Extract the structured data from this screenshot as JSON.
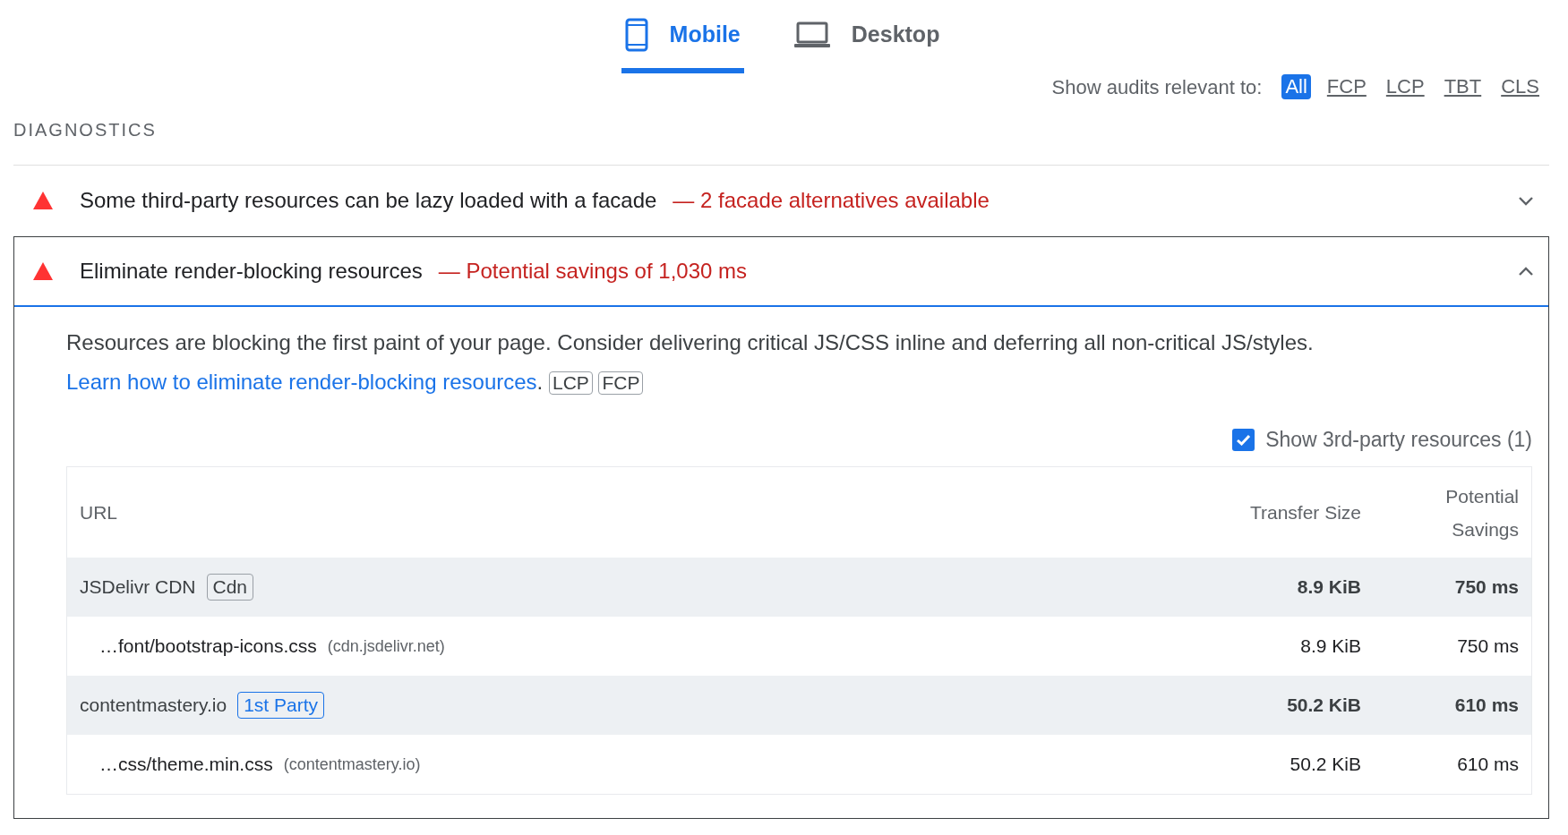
{
  "tabs": [
    {
      "label": "Mobile",
      "kind": "phone",
      "selected": true
    },
    {
      "label": "Desktop",
      "kind": "laptop",
      "selected": false
    }
  ],
  "filter": {
    "label": "Show audits relevant to:",
    "options": [
      {
        "label": "All",
        "selected": true
      },
      {
        "label": "FCP",
        "selected": false
      },
      {
        "label": "LCP",
        "selected": false
      },
      {
        "label": "TBT",
        "selected": false
      },
      {
        "label": "CLS",
        "selected": false
      }
    ]
  },
  "section_title": "DIAGNOSTICS",
  "audits": [
    {
      "title": "Some third-party resources can be lazy loaded with a facade",
      "display_value": "— 2 facade alternatives available",
      "expanded": false
    },
    {
      "title": "Eliminate render-blocking resources",
      "display_value": "— Potential savings of 1,030 ms",
      "expanded": true,
      "description": "Resources are blocking the first paint of your page. Consider delivering critical JS/CSS inline and deferring all non-critical JS/styles.",
      "link": "Learn how to eliminate render-blocking resources",
      "after_link": ".",
      "tags": [
        "LCP",
        "FCP"
      ],
      "third_party_toggle": {
        "label": "Show 3rd-party resources (1)",
        "checked": true
      },
      "table": {
        "columns": [
          "URL",
          "Transfer Size",
          "Potential Savings"
        ],
        "rows": [
          {
            "kind": "group",
            "name": "JSDelivr CDN",
            "badge": {
              "label": "Cdn",
              "color": "#9aa0a6"
            },
            "transfer_size": "8.9 KiB",
            "savings": "750 ms"
          },
          {
            "kind": "item",
            "name": "…font/bootstrap-icons.css",
            "host": "(cdn.jsdelivr.net)",
            "transfer_size": "8.9 KiB",
            "savings": "750 ms"
          },
          {
            "kind": "group",
            "name": "contentmastery.io",
            "badge": {
              "label": "1st Party",
              "color": "#1a73e8"
            },
            "transfer_size": "50.2 KiB",
            "savings": "610 ms"
          },
          {
            "kind": "item",
            "name": "…css/theme.min.css",
            "host": "(contentmastery.io)",
            "transfer_size": "50.2 KiB",
            "savings": "610 ms"
          }
        ]
      }
    }
  ]
}
